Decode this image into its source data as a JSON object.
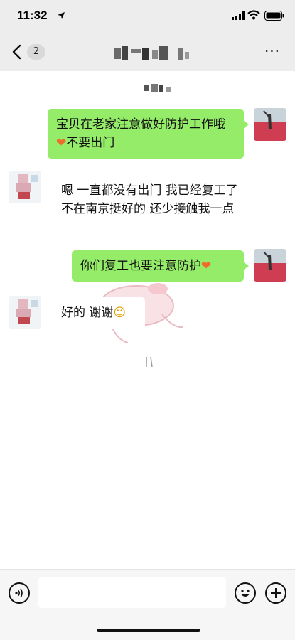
{
  "status_bar": {
    "time": "11:32",
    "icons": [
      "location-arrow-icon",
      "cellular-signal-icon",
      "wifi-icon",
      "battery-icon"
    ]
  },
  "nav_bar": {
    "unread_count": "2",
    "more_label": "···"
  },
  "messages": [
    {
      "side": "self",
      "text_before": "宝贝在老家注意做好防护工作哦",
      "emoji": "❤",
      "text_after": "不要出门"
    },
    {
      "side": "peer",
      "text": "嗯 一直都没有出门 我已经复工了 不在南京挺好的 还少接触我一点"
    },
    {
      "side": "self",
      "text": "你们复工也要注意防护",
      "emoji": "❤"
    },
    {
      "side": "peer",
      "text": "好的 谢谢",
      "emoji": "☺"
    }
  ],
  "colors": {
    "header_bg": "#ededed",
    "self_bubble": "#95ec69",
    "heart": "#f06a2b"
  }
}
